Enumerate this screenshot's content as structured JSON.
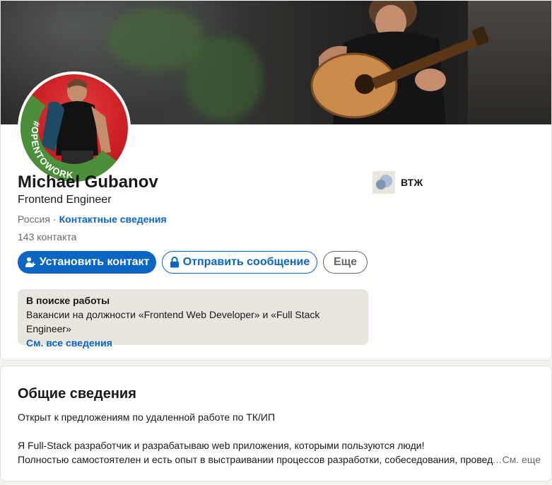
{
  "profile": {
    "name": "Michael Gubanov",
    "headline": "Frontend Engineer",
    "location": "Россия",
    "separator": "·",
    "contact_info_link": "Контактные сведения",
    "connections": "143 контакта",
    "avatar_badge": "#OPENTOWORK",
    "company": "ВТЖ"
  },
  "actions": {
    "connect_label": "Установить контакт",
    "message_label": "Отправить сообщение",
    "more_label": "Еще"
  },
  "open_to_work": {
    "title": "В поиске работы",
    "description": "Вакансии на должности «Frontend Web Developer» и «Full Stack Engineer»",
    "link": "См. все сведения"
  },
  "about": {
    "title": "Общие сведения",
    "line1": "Открыт к предложениям по удаленной работе по ТК/ИП",
    "line2": "Я Full-Stack разработчик и разрабатываю web приложения, которыми пользуются люди!",
    "line3": "Полностью самостоятелен и есть опыт в выстраивании процессов разработки, собеседования, провед",
    "see_more": "…См. еще"
  },
  "colors": {
    "accent": "#0a66c2",
    "open_to_work_green": "#4c8f3a",
    "avatar_bg": "#c81e24",
    "panel_bg": "#e9e5df"
  },
  "icons": {
    "connect": "person-add-icon",
    "message": "lock-icon",
    "company": "company-logo-icon"
  }
}
